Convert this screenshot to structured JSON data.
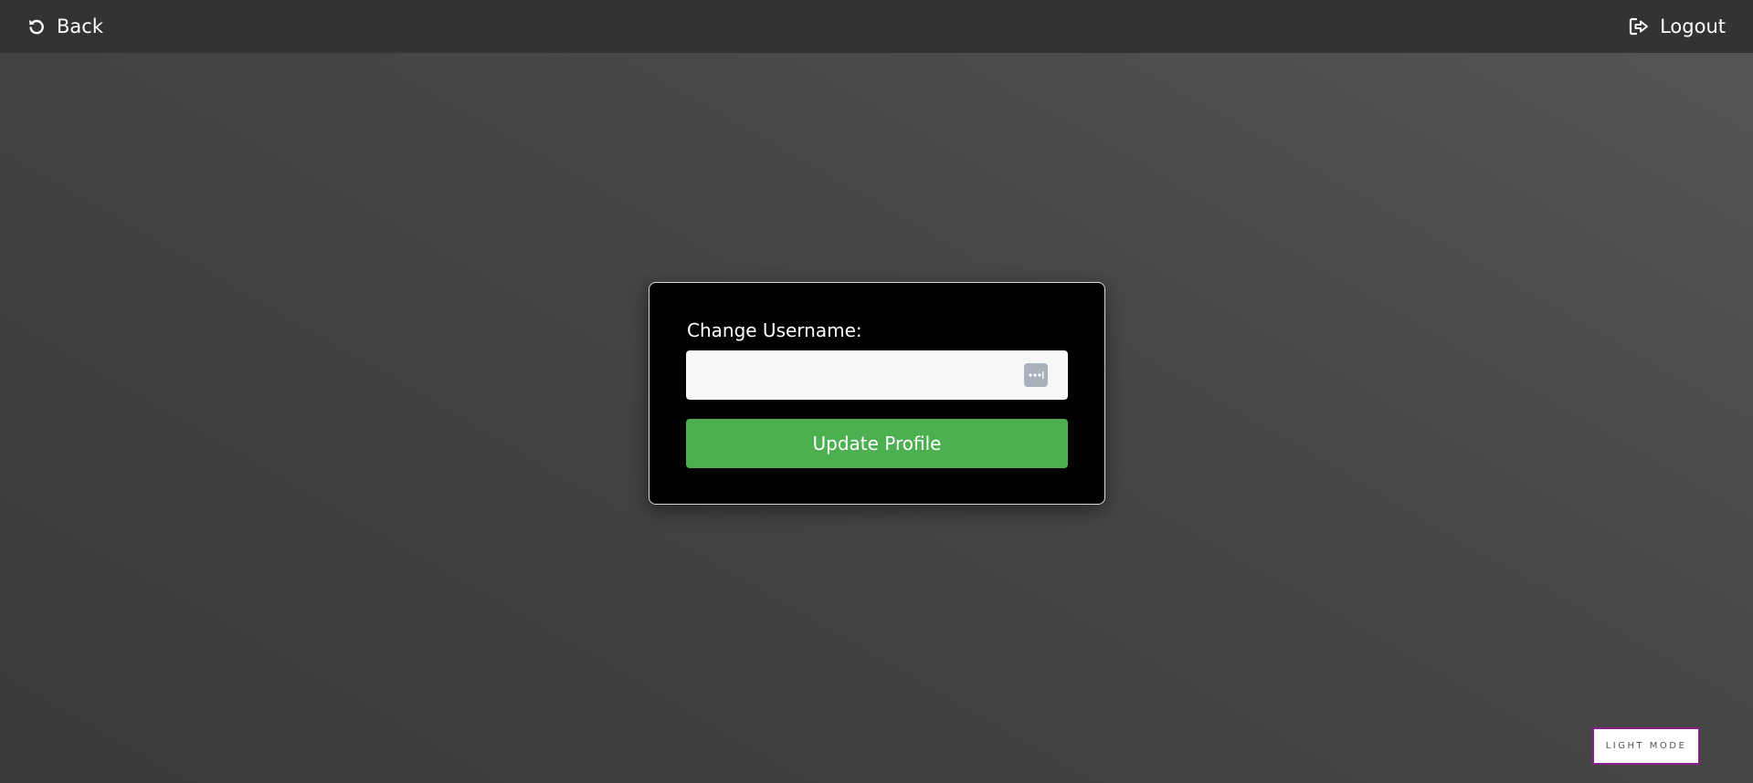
{
  "header": {
    "back_label": "Back",
    "back_icon": "undo-arrow-icon",
    "logout_label": "Logout",
    "logout_icon": "sign-out-icon"
  },
  "form": {
    "label": "Change Username:",
    "username_value": "",
    "username_placeholder": "",
    "password_manager_icon": "password-manager-icon",
    "submit_label": "Update Profile"
  },
  "theme_toggle": {
    "label": "LIGHT MODE"
  },
  "colors": {
    "topbar": "#333333",
    "card_background": "#000000",
    "submit_button": "#4caf50",
    "toggle_border": "#8a1f8f"
  }
}
